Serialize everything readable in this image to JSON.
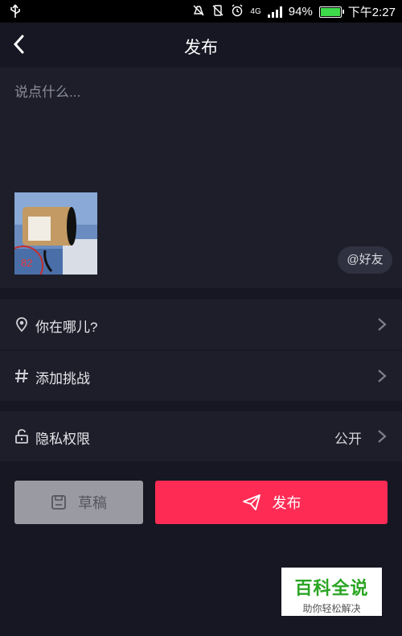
{
  "status_bar": {
    "usb_icon": "usb-icon",
    "network": "4G",
    "battery": "94%",
    "battery_level": 0.94,
    "time": "下午2:27"
  },
  "header": {
    "title": "发布"
  },
  "compose": {
    "caption_placeholder": "说点什么...",
    "video_badge": "82",
    "mention_label": "@好友"
  },
  "settings": {
    "location_label": "你在哪儿?",
    "challenge_label": "添加挑战",
    "privacy_label": "隐私权限",
    "privacy_value": "公开"
  },
  "actions": {
    "draft_label": "草稿",
    "publish_label": "发布"
  },
  "watermark": {
    "title": "百科全说",
    "subtitle": "助你轻松解决"
  },
  "colors": {
    "background": "#161722",
    "panel": "#1d1e29",
    "publish_button": "#fe2c55",
    "draft_button": "#9a9ba2",
    "watermark_green": "#2aa523"
  }
}
